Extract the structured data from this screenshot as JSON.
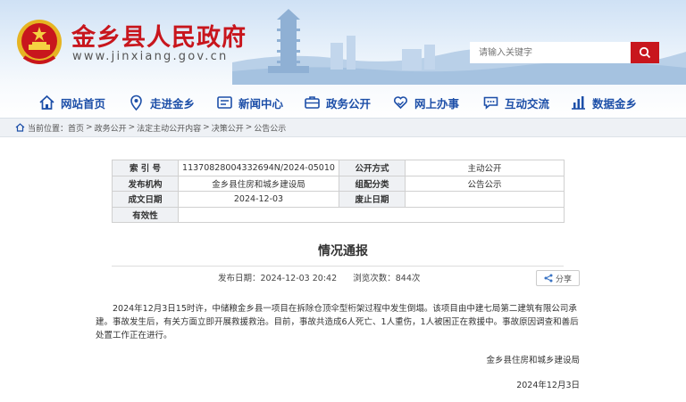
{
  "header": {
    "site_title": "金乡县人民政府",
    "site_url": "www.jinxiang.gov.cn",
    "brand_color": "#c8161d",
    "search_placeholder": "请输入关键字"
  },
  "nav": {
    "color": "#1d4fa8",
    "items": [
      {
        "label": "网站首页",
        "icon": "home-icon"
      },
      {
        "label": "走进金乡",
        "icon": "location-pin-icon"
      },
      {
        "label": "新闻中心",
        "icon": "news-icon"
      },
      {
        "label": "政务公开",
        "icon": "briefcase-icon"
      },
      {
        "label": "网上办事",
        "icon": "heart-hands-icon"
      },
      {
        "label": "互动交流",
        "icon": "chat-icon"
      },
      {
        "label": "数据金乡",
        "icon": "chart-icon"
      }
    ]
  },
  "breadcrumb": {
    "prefix": "当前位置：",
    "items": [
      "首页",
      "政务公开",
      "法定主动公开内容",
      "决策公开",
      "公告公示"
    ]
  },
  "info_table": {
    "index_label": "索 引 号",
    "index_value": "11370828004332694N/2024-05010",
    "disclosure_label": "公开方式",
    "disclosure_value": "主动公开",
    "publisher_label": "发布机构",
    "publisher_value": "金乡县住房和城乡建设局",
    "category_label": "组配分类",
    "category_value": "公告公示",
    "date_label": "成文日期",
    "date_value": "2024-12-03",
    "abolish_label": "废止日期",
    "abolish_value": "",
    "validity_label": "有效性",
    "validity_value": ""
  },
  "article": {
    "title": "情况通报",
    "publish_time": "发布日期：2024-12-03 20:42",
    "views": "浏览次数：844次",
    "share_label": "分享",
    "body": "2024年12月3日15时许，中储粮金乡县一项目在拆除仓顶伞型桁架过程中发生倒塌。该项目由中建七局第二建筑有限公司承建。事故发生后，有关方面立即开展救援救治。目前，事故共造成6人死亡、1人重伤，1人被困正在救援中。事故原因调查和善后处置工作正在进行。",
    "signature": "金乡县住房和城乡建设局",
    "sign_date": "2024年12月3日"
  }
}
